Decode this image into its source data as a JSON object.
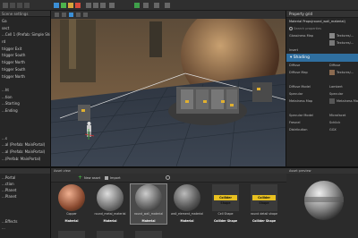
{
  "left_panel": {
    "header": "Scene settings",
    "items": [
      {
        "label": "Ga",
        "selected": false
      },
      {
        "label": "sect",
        "selected": false
      },
      {
        "label": "...Cell 1 (Prefab: Simple Ship)",
        "selected": false
      },
      {
        "label": "rd",
        "selected": false
      },
      {
        "label": "trigger Exit",
        "selected": false
      },
      {
        "label": "trigger South",
        "selected": false
      },
      {
        "label": "trigger North",
        "selected": false
      },
      {
        "label": "trigger South",
        "selected": false
      },
      {
        "label": "trigger North",
        "selected": false
      },
      {
        "label": "",
        "selected": false
      },
      {
        "label": "...ht",
        "selected": false
      },
      {
        "label": "...tion",
        "selected": false
      },
      {
        "label": "...Starting",
        "selected": false
      },
      {
        "label": "...Ending",
        "selected": false
      },
      {
        "label": "",
        "selected": false
      },
      {
        "label": "",
        "selected": false
      },
      {
        "label": "",
        "selected": false
      },
      {
        "label": "...s",
        "selected": false
      },
      {
        "label": "...al (Prefab: MainPortal)",
        "selected": false
      },
      {
        "label": "...al (Prefab: MainPortal)",
        "selected": false
      },
      {
        "label": "...(Prefab: MainPortal)",
        "selected": false
      }
    ]
  },
  "assets_left": {
    "items": [
      "...Portal",
      "...ction",
      "...Planet",
      "...Planet",
      "",
      "",
      "",
      "...Effects",
      "..."
    ]
  },
  "property_grid": {
    "title": "Property grid",
    "material_path": "Material Props(round_wall_material)",
    "search_placeholder": "Search properties",
    "rows": [
      {
        "label": "Glossiness Map",
        "value": "Textures/..."
      },
      {
        "label": "",
        "value": "Textures/..."
      },
      {
        "label": "Insert",
        "value": ""
      }
    ],
    "section_title": "Shading",
    "shading_rows": [
      {
        "label": "Diffuse",
        "value": "Diffuse"
      },
      {
        "label": "Diffuse Map",
        "value": "Textures/..."
      },
      {
        "label": "",
        "value": ""
      },
      {
        "label": "Diffuse Model",
        "value": "Lambert"
      },
      {
        "label": "Specular",
        "value": "Specular"
      },
      {
        "label": "Metalness Map",
        "value": "Metalness Ma..."
      },
      {
        "label": "",
        "value": ""
      },
      {
        "label": "Specular Model",
        "value": "Microfacet"
      },
      {
        "label": "Fresnel",
        "value": "Schlick"
      },
      {
        "label": "Distribution",
        "value": "GGX"
      }
    ]
  },
  "asset_view": {
    "title": "Asset view",
    "new_asset": "New asset",
    "import": "Import",
    "tiles": [
      {
        "name": "Copper",
        "type": "Material",
        "kind": "copper"
      },
      {
        "name": "round_metal_material",
        "type": "Material",
        "kind": "metal"
      },
      {
        "name": "round_wall_material",
        "type": "Material",
        "kind": "wall",
        "selected": true
      },
      {
        "name": "wall_element_material",
        "type": "Material",
        "kind": "wall2"
      },
      {
        "name": "Cell Shape",
        "type": "Collider Shape",
        "kind": "collider"
      },
      {
        "name": "round detail shape",
        "type": "Collider Shape",
        "kind": "collider"
      }
    ],
    "badge": "Collider Shape"
  },
  "asset_preview": {
    "title": "Asset preview"
  },
  "colors": {
    "accent": "#2f6fa0",
    "selection": "#3a5f84",
    "badge": "#e8c020"
  }
}
